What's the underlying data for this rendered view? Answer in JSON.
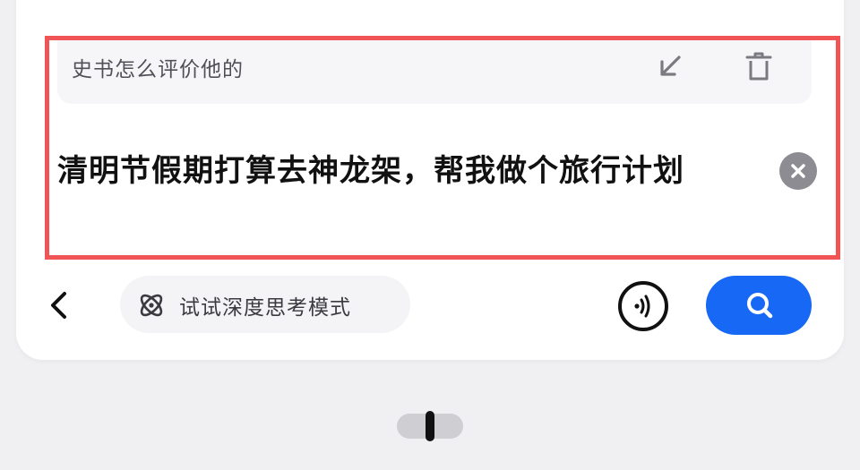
{
  "history": {
    "suggestion_text": "史书怎么评价他的",
    "fill_icon": "arrow-up-left-icon",
    "delete_icon": "trash-icon"
  },
  "query": {
    "text": "清明节假期打算去神龙架，帮我做个旅行计划",
    "clear_icon": "close-circle-icon"
  },
  "toolbar": {
    "back_icon": "chevron-left-icon",
    "deep_mode_label": "试试深度思考模式",
    "deep_mode_icon": "atom-icon",
    "voice_icon": "voice-wave-icon",
    "search_icon": "search-icon"
  },
  "colors": {
    "accent": "#1668f5",
    "highlight_border": "#f05454",
    "card_bg": "#ffffff",
    "page_bg": "#f0f0f2"
  }
}
